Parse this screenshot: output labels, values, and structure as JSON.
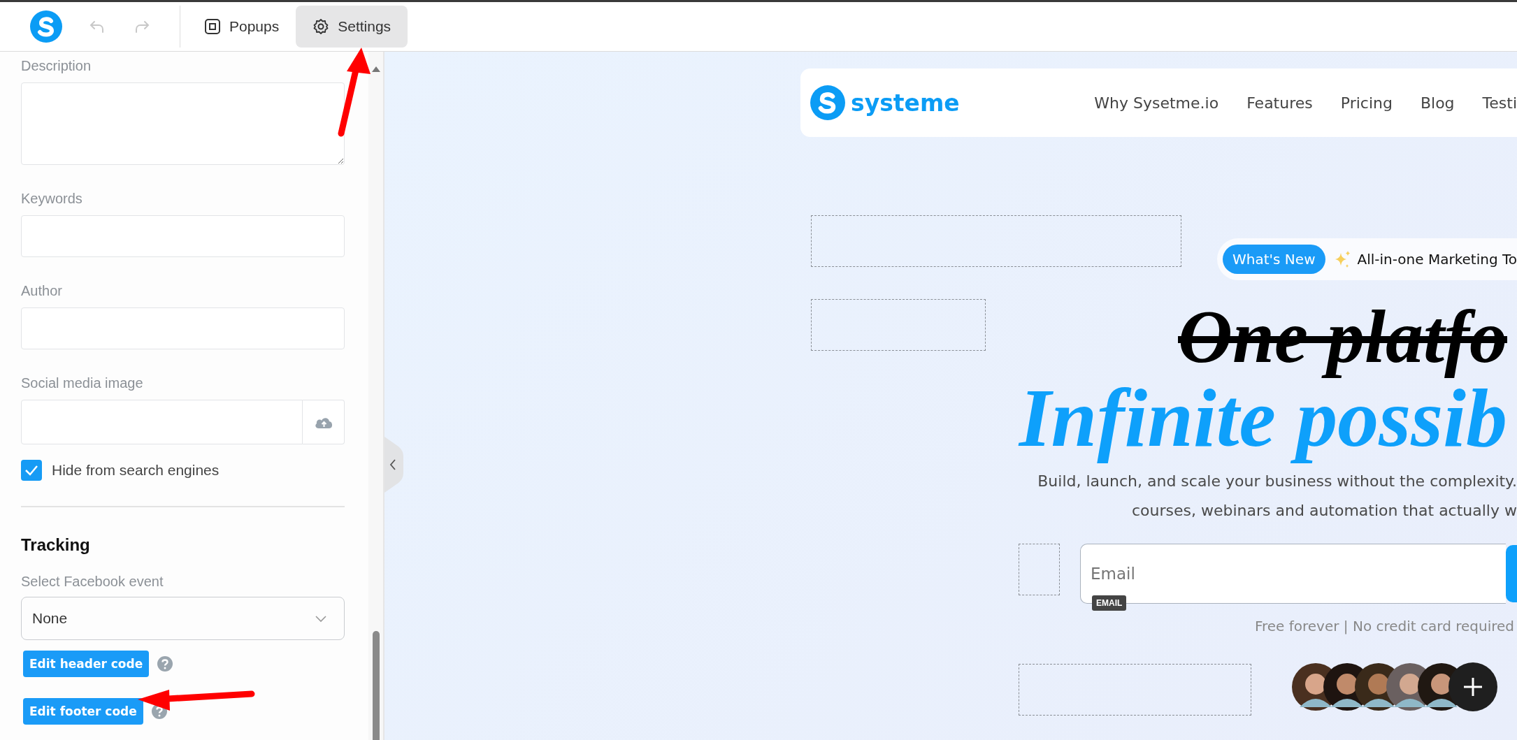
{
  "toolbar": {
    "undo": {
      "disabled": true
    },
    "redo": {
      "disabled": true
    },
    "tabs": [
      {
        "label": "Popups",
        "kind": "popup",
        "selected": false
      },
      {
        "label": "Settings",
        "kind": "gear",
        "selected": true
      }
    ]
  },
  "settings_panel": {
    "fields": [
      {
        "kind": "textarea",
        "label": "Description"
      },
      {
        "kind": "text",
        "label": "Keywords"
      },
      {
        "kind": "text",
        "label": "Author"
      },
      {
        "kind": "upload",
        "label": "Social media image"
      }
    ],
    "checkbox": {
      "label": "Hide from search engines",
      "checked": true
    },
    "tracking": {
      "title": "Tracking",
      "select": {
        "label": "Select Facebook event",
        "value": "None"
      },
      "buttons": [
        {
          "label": "Edit header code"
        },
        {
          "label": "Edit footer code"
        }
      ]
    }
  },
  "page_preview": {
    "logo": "systeme",
    "nav": [
      "Why Sysetme.io",
      "Features",
      "Pricing",
      "Blog",
      "Testi"
    ],
    "badge": {
      "label": "What's New",
      "text": "All-in-one Marketing To"
    },
    "heading_struck": "One platfo",
    "heading": "Infinite possib",
    "subtitle": [
      "Build, launch, and scale your business without the complexity.",
      "courses, webinars and automation that actually w"
    ],
    "email": {
      "placeholder": "Email",
      "tag": "EMAIL"
    },
    "note": "Free forever | No credit card required"
  }
}
